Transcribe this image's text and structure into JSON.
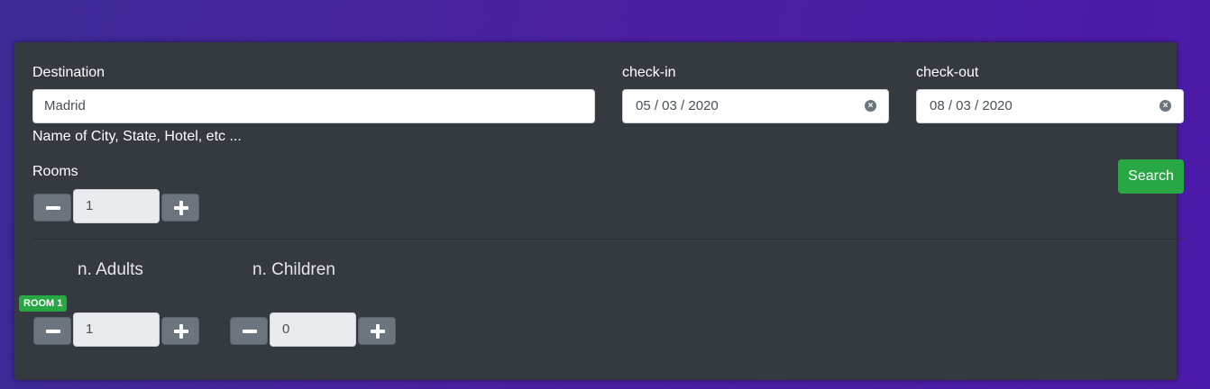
{
  "search_form": {
    "destination": {
      "label": "Destination",
      "value": "Madrid",
      "help_text": "Name of City, State, Hotel, etc ..."
    },
    "check_in": {
      "label": "check-in",
      "value": "05 / 03 / 2020",
      "clear_icon": "clear-circle-icon"
    },
    "check_out": {
      "label": "check-out",
      "value": "08 / 03 / 2020",
      "clear_icon": "clear-circle-icon"
    },
    "rooms": {
      "label": "Rooms",
      "value": "1"
    },
    "search_button_label": "Search"
  },
  "room_details": {
    "adults_header": "n. Adults",
    "children_header": "n. Children",
    "rooms": [
      {
        "badge": "ROOM 1",
        "adults": "1",
        "children": "0"
      }
    ]
  },
  "colors": {
    "panel_bg": "#343a40",
    "accent_green": "#28a745",
    "stepper_gray": "#6c757d",
    "background_purple": "#4a1fa0"
  }
}
